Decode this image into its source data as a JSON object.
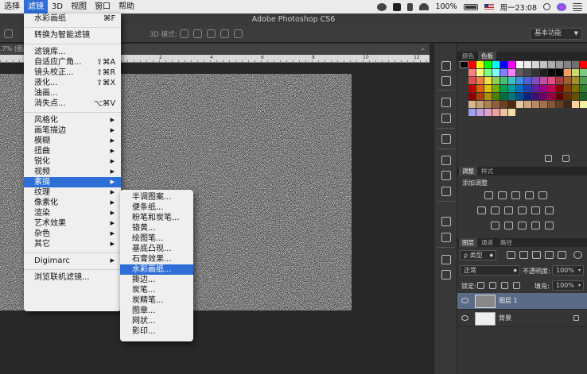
{
  "menubar": {
    "items": [
      "选择",
      "滤镜",
      "3D",
      "视图",
      "窗口",
      "帮助"
    ],
    "active_index": 1,
    "battery": "100%",
    "clock": "周一23:08"
  },
  "app_title": "Adobe Photoshop CS6",
  "options_bar": {
    "mode_label": "3D 模式:",
    "workspace": "基本功能"
  },
  "document_tab": ".7% (图层",
  "ruler_numbers": [
    "2",
    "4",
    "6",
    "8",
    "10",
    "12"
  ],
  "filter_menu": {
    "items": [
      {
        "label": "水彩画纸",
        "shortcut": "⌘F"
      },
      {
        "sep": true
      },
      {
        "label": "转换为智能滤镜"
      },
      {
        "sep": true
      },
      {
        "label": "滤镜库..."
      },
      {
        "label": "自适应广角...",
        "shortcut": "⇧⌘A"
      },
      {
        "label": "镜头校正...",
        "shortcut": "⇧⌘R"
      },
      {
        "label": "液化...",
        "shortcut": "⇧⌘X"
      },
      {
        "label": "油画..."
      },
      {
        "label": "消失点...",
        "shortcut": "⌥⌘V"
      },
      {
        "sep": true
      },
      {
        "label": "风格化",
        "submenu": true
      },
      {
        "label": "画笔描边",
        "submenu": true
      },
      {
        "label": "模糊",
        "submenu": true
      },
      {
        "label": "扭曲",
        "submenu": true
      },
      {
        "label": "锐化",
        "submenu": true
      },
      {
        "label": "视频",
        "submenu": true
      },
      {
        "label": "素描",
        "submenu": true,
        "highlighted": true
      },
      {
        "label": "纹理",
        "submenu": true
      },
      {
        "label": "像素化",
        "submenu": true
      },
      {
        "label": "渲染",
        "submenu": true
      },
      {
        "label": "艺术效果",
        "submenu": true
      },
      {
        "label": "杂色",
        "submenu": true
      },
      {
        "label": "其它",
        "submenu": true
      },
      {
        "sep": true
      },
      {
        "label": "Digimarc",
        "submenu": true
      },
      {
        "sep": true
      },
      {
        "label": "浏览联机滤镜..."
      }
    ]
  },
  "sketch_menu": {
    "items": [
      "半调图案...",
      "便条纸...",
      "粉笔和炭笔...",
      "铬黄...",
      "绘图笔...",
      "基底凸现...",
      "石膏效果...",
      "水彩画纸...",
      "撕边...",
      "炭笔...",
      "炭精笔...",
      "图章...",
      "网状...",
      "影印..."
    ],
    "highlighted_index": 7
  },
  "panels": {
    "color_tabs": [
      "颜色",
      "色板"
    ],
    "color_active": 1,
    "adjust_tabs": [
      "调整",
      "样式"
    ],
    "adjust_active": 0,
    "adjust_title": "添加调整",
    "layer_tabs": [
      "图层",
      "通道",
      "路径"
    ],
    "layer_active": 0,
    "filter_kind": "ρ 类型",
    "blend_mode": "正常",
    "opacity_label": "不透明度:",
    "opacity_value": "100%",
    "lock_label": "锁定:",
    "fill_label": "填充:",
    "fill_value": "100%",
    "layers": [
      {
        "name": "图层 1",
        "selected": true
      },
      {
        "name": "背景",
        "selected": false,
        "locked": true
      }
    ]
  },
  "swatches": [
    "#ff0000",
    "#ffff00",
    "#00ff00",
    "#00ffff",
    "#0000ff",
    "#ff00ff",
    "#ffffff",
    "#ebebeb",
    "#d6d6d6",
    "#c2c2c2",
    "#adadad",
    "#999999",
    "#858585",
    "#707070",
    "#ff0000",
    "#ff8080",
    "#ffff80",
    "#80ff80",
    "#80ffff",
    "#8080ff",
    "#ff80ff",
    "#5c5c5c",
    "#474747",
    "#333333",
    "#1f1f1f",
    "#0a0a0a",
    "#000000",
    "#f5a060",
    "#c8d870",
    "#7ec87e",
    "#e05050",
    "#f08040",
    "#f0e040",
    "#90d050",
    "#40c070",
    "#40c0c0",
    "#4090e0",
    "#5060d0",
    "#8050c0",
    "#c050a0",
    "#e05080",
    "#a04040",
    "#a06030",
    "#a09030",
    "#50a050",
    "#c00000",
    "#e06000",
    "#e0c000",
    "#70b000",
    "#00a050",
    "#00a0a0",
    "#0070c0",
    "#2040b0",
    "#6020a0",
    "#a00080",
    "#c00050",
    "#800000",
    "#804000",
    "#807000",
    "#308030",
    "#900000",
    "#b04000",
    "#b09000",
    "#508000",
    "#007040",
    "#007878",
    "#005090",
    "#102080",
    "#401070",
    "#700060",
    "#900040",
    "#600000",
    "#603000",
    "#605000",
    "#206020",
    "#d8b890",
    "#c8a070",
    "#b08050",
    "#906040",
    "#704020",
    "#502810",
    "#e8c8a8",
    "#d0a880",
    "#b88860",
    "#a07050",
    "#805838",
    "#604028",
    "#402818",
    "#ffd0a0",
    "#f0f0a0",
    "#a0a0f0",
    "#c0a0e0",
    "#e0a0d0",
    "#f0a0a0",
    "#f0c0a0",
    "#f0e0a0"
  ]
}
